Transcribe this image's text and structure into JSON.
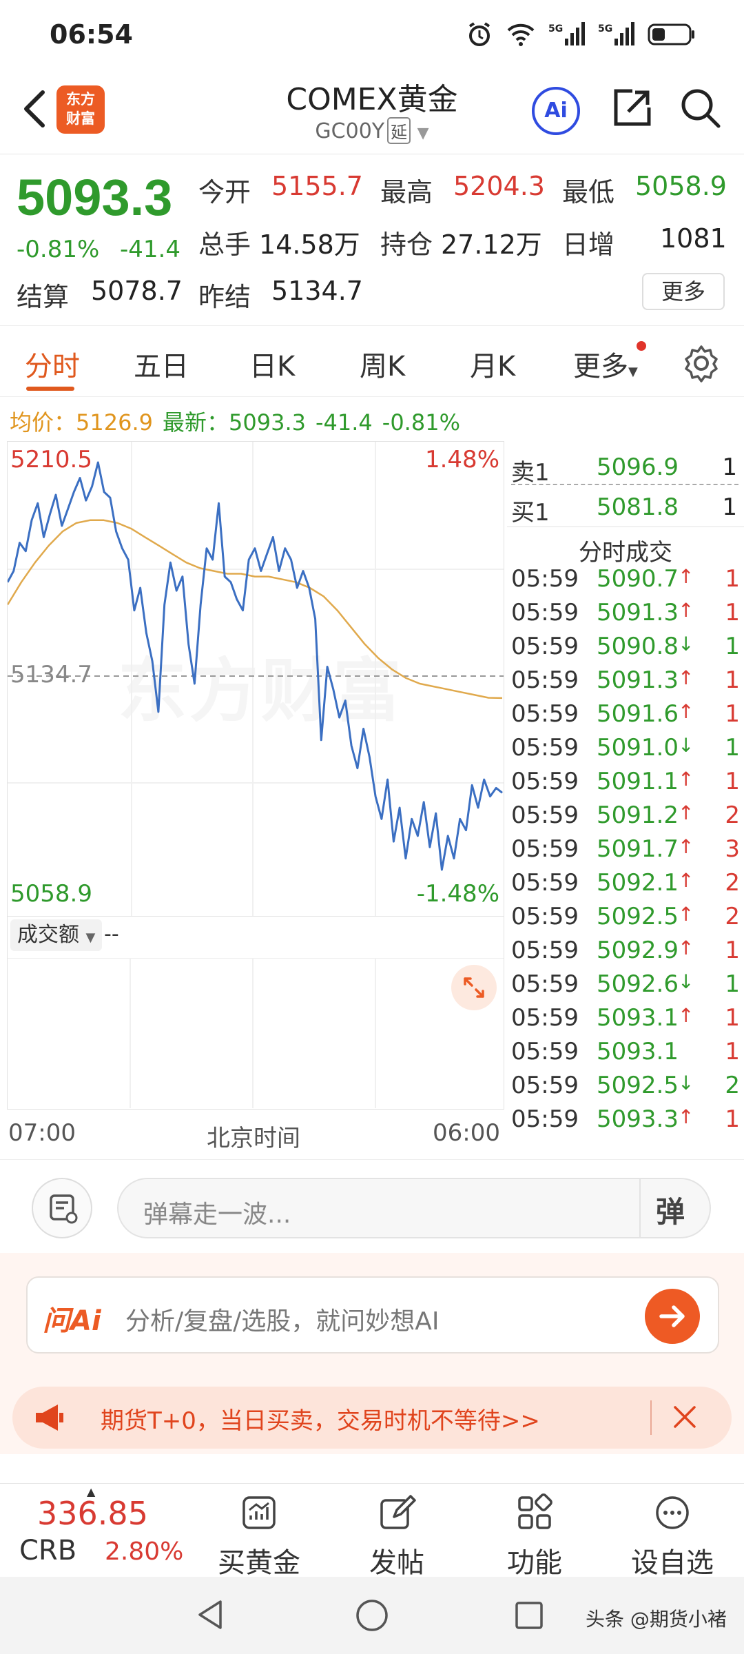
{
  "status_bar": {
    "time": "06:54"
  },
  "header": {
    "title": "COMEX黄金",
    "code": "GC00Y",
    "delay_tag": "延",
    "logo_line1": "东方",
    "logo_line2": "财富",
    "ai_label": "Ai"
  },
  "quote": {
    "last_price": "5093.3",
    "change_pct": "-0.81%",
    "change_abs": "-41.4",
    "open_label": "今开",
    "open_value": "5155.7",
    "high_label": "最高",
    "high_value": "5204.3",
    "low_label": "最低",
    "low_value": "5058.9",
    "volume_label": "总手",
    "volume_value": "14.58万",
    "oi_label": "持仓",
    "oi_value": "27.12万",
    "daily_inc_label": "日增",
    "daily_inc_value": "1081",
    "settle_label": "结算",
    "settle_value": "5078.7",
    "prev_settle_label": "昨结",
    "prev_settle_value": "5134.7",
    "more_label": "更多"
  },
  "tabs": [
    "分时",
    "五日",
    "日K",
    "周K",
    "月K",
    "更多"
  ],
  "info_line": {
    "avg_label": "均价：",
    "avg_value": "5126.9",
    "latest_label": "最新：",
    "latest_value": "5093.3",
    "change_abs": "-41.4",
    "change_pct": "-0.81%"
  },
  "chart_labels": {
    "max_price": "5210.5",
    "max_pct": "1.48%",
    "min_price": "5058.9",
    "min_pct": "-1.48%",
    "prev_settle": "5134.7",
    "watermark": "东方财富",
    "volume_selector": "成交额",
    "volume_value": "--",
    "time_start": "07:00",
    "time_mid": "北京时间",
    "time_end": "06:00"
  },
  "chart_data": {
    "type": "line",
    "ylim": [
      5058.9,
      5210.5
    ],
    "reference_line": 5134.7,
    "series": [
      {
        "values": [
          5168,
          5172,
          5182,
          5179,
          5190,
          5196,
          5184,
          5192,
          5199,
          5188,
          5194,
          5200,
          5205,
          5197,
          5202,
          5210.5,
          5200,
          5198,
          5186,
          5180,
          5176,
          5158,
          5166,
          5150,
          5140,
          5122,
          5160,
          5175,
          5165,
          5170,
          5146,
          5132,
          5160,
          5180,
          5176,
          5196,
          5170,
          5168,
          5162,
          5158,
          5176,
          5180,
          5172,
          5178,
          5184,
          5172,
          5180,
          5176,
          5166,
          5172,
          5166,
          5155,
          5112,
          5138,
          5130,
          5120,
          5126,
          5110,
          5102,
          5116,
          5106,
          5092,
          5084,
          5098,
          5076,
          5088,
          5070,
          5084,
          5078,
          5090,
          5074,
          5086,
          5066,
          5078,
          5070,
          5084,
          5080,
          5096,
          5088,
          5098,
          5092,
          5095,
          5093.3
        ]
      },
      {
        "name": "均价",
        "values": [
          5160,
          5168,
          5175,
          5181,
          5186,
          5189,
          5190,
          5190,
          5189,
          5187,
          5184,
          5181,
          5178,
          5175,
          5173,
          5172,
          5171,
          5171,
          5170,
          5170,
          5169,
          5168,
          5166,
          5163,
          5158,
          5152,
          5146,
          5141,
          5137,
          5134,
          5132,
          5131,
          5130,
          5129,
          5128,
          5127,
          5126.9
        ]
      }
    ]
  },
  "order_book": {
    "ask_label": "卖1",
    "ask_price": "5096.9",
    "ask_qty": "1",
    "bid_label": "买1",
    "bid_price": "5081.8",
    "bid_qty": "1"
  },
  "trades_title": "分时成交",
  "trades": [
    {
      "time": "05:59",
      "price": "5090.7",
      "dir": "↑",
      "qty": "1"
    },
    {
      "time": "05:59",
      "price": "5091.3",
      "dir": "↑",
      "qty": "1"
    },
    {
      "time": "05:59",
      "price": "5090.8",
      "dir": "↓",
      "qty": "1"
    },
    {
      "time": "05:59",
      "price": "5091.3",
      "dir": "↑",
      "qty": "1"
    },
    {
      "time": "05:59",
      "price": "5091.6",
      "dir": "↑",
      "qty": "1"
    },
    {
      "time": "05:59",
      "price": "5091.0",
      "dir": "↓",
      "qty": "1"
    },
    {
      "time": "05:59",
      "price": "5091.1",
      "dir": "↑",
      "qty": "1"
    },
    {
      "time": "05:59",
      "price": "5091.2",
      "dir": "↑",
      "qty": "2"
    },
    {
      "time": "05:59",
      "price": "5091.7",
      "dir": "↑",
      "qty": "3"
    },
    {
      "time": "05:59",
      "price": "5092.1",
      "dir": "↑",
      "qty": "2"
    },
    {
      "time": "05:59",
      "price": "5092.5",
      "dir": "↑",
      "qty": "2"
    },
    {
      "time": "05:59",
      "price": "5092.9",
      "dir": "↑",
      "qty": "1"
    },
    {
      "time": "05:59",
      "price": "5092.6",
      "dir": "↓",
      "qty": "1"
    },
    {
      "time": "05:59",
      "price": "5093.1",
      "dir": "↑",
      "qty": "1"
    },
    {
      "time": "05:59",
      "price": "5093.1",
      "dir": "",
      "qty": "1"
    },
    {
      "time": "05:59",
      "price": "5092.5",
      "dir": "↓",
      "qty": "2"
    },
    {
      "time": "05:59",
      "price": "5093.3",
      "dir": "↑",
      "qty": "1"
    }
  ],
  "comment": {
    "placeholder": "弹幕走一波...",
    "danmu_label": "弹"
  },
  "ai_bar": {
    "logo": "问Ai",
    "placeholder": "分析/复盘/选股，就问妙想AI"
  },
  "promo": {
    "text": "期货T+0，当日买卖，交易时机不等待>>"
  },
  "bottom": {
    "index_value": "336.85",
    "index_name": "CRB",
    "index_pct": "2.80%",
    "nav": [
      "买黄金",
      "发帖",
      "功能",
      "设自选"
    ]
  },
  "footer_watermark": "头条 @期货小褚",
  "colors": {
    "up": "#d83a32",
    "down": "#2f9a2c",
    "accent": "#e0591e",
    "line": "#3b6fc2",
    "avg_line": "#e0a94c"
  }
}
